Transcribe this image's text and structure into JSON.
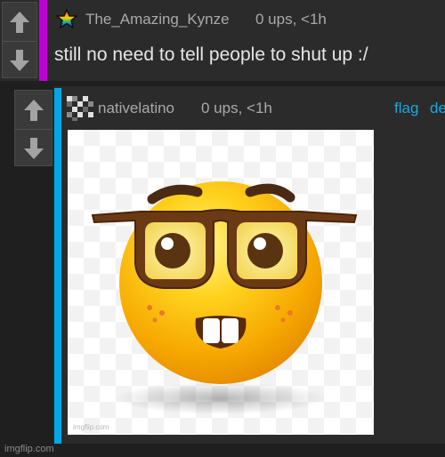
{
  "comments": [
    {
      "username": "The_Amazing_Kynze",
      "meta": "0 ups, <1h",
      "text": "still no need to tell people to shut up :/",
      "bar_color": "#c000d8",
      "icon": "rainbow-star-icon"
    },
    {
      "username": "nativelatino",
      "meta": "0 ups, <1h",
      "bar_color": "#00a8e8",
      "icon": "pixel-avatar-icon",
      "actions": {
        "flag": "flag",
        "delete": "de"
      },
      "image": {
        "description_icon": "nerd-emoji-icon",
        "watermark": "imgflip.com"
      }
    }
  ],
  "footer": {
    "watermark": "imgflip.com"
  }
}
